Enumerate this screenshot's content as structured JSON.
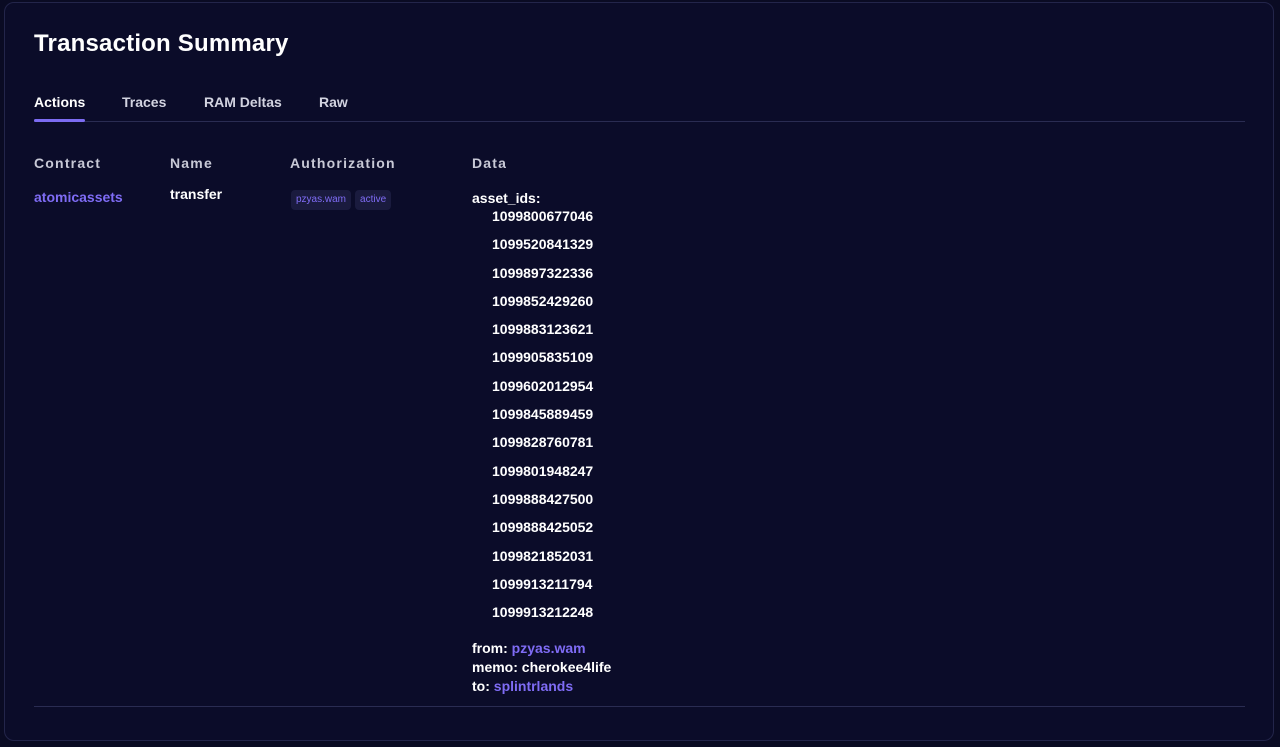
{
  "page": {
    "title": "Transaction Summary"
  },
  "tabs": [
    {
      "label": "Actions",
      "active": true
    },
    {
      "label": "Traces",
      "active": false
    },
    {
      "label": "RAM Deltas",
      "active": false
    },
    {
      "label": "Raw",
      "active": false
    }
  ],
  "table": {
    "headers": {
      "contract": "Contract",
      "name": "Name",
      "authorization": "Authorization",
      "data": "Data"
    },
    "row": {
      "contract": "atomicassets",
      "name": "transfer",
      "authorization": [
        "pzyas.wam",
        "active"
      ],
      "data": {
        "asset_ids_label": "asset_ids:",
        "asset_ids": [
          "1099800677046",
          "1099520841329",
          "1099897322336",
          "1099852429260",
          "1099883123621",
          "1099905835109",
          "1099602012954",
          "1099845889459",
          "1099828760781",
          "1099801948247",
          "1099888427500",
          "1099888425052",
          "1099821852031",
          "1099913211794",
          "1099913212248"
        ],
        "from_label": "from:",
        "from": "pzyas.wam",
        "memo_label": "memo:",
        "memo": "cherokee4life",
        "to_label": "to:",
        "to": "splintrlands"
      }
    }
  },
  "colors": {
    "background": "#0a0b23",
    "accent": "#7f6cf5",
    "text": "#ffffff"
  }
}
